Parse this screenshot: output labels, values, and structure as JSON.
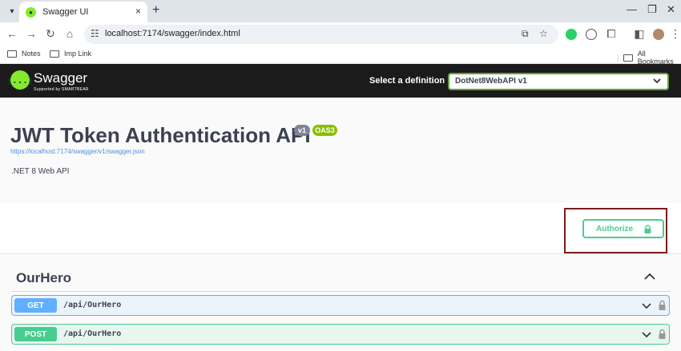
{
  "browser": {
    "tab_title": "Swagger UI",
    "tab_menu_icon": "chevron-down-icon",
    "close_glyph": "×",
    "new_tab_glyph": "+",
    "url": "localhost:7174/swagger/index.html",
    "bookmarks": [
      {
        "label": "Notes"
      },
      {
        "label": "Imp Link"
      }
    ],
    "all_bookmarks": "All Bookmarks"
  },
  "topbar": {
    "logo_text": "Swagger",
    "logo_sub": "Supported by SMARTBEAR",
    "logo_glyph": "{...}",
    "select_label": "Select a definition",
    "selected_definition": "DotNet8WebAPI v1"
  },
  "info": {
    "title": "JWT Token Authentication API",
    "version": "v1",
    "oas": "OAS3",
    "spec_url": "https://localhost:7174/swagger/v1/swagger.json",
    "description": ".NET 8 Web API"
  },
  "auth": {
    "button_label": "Authorize"
  },
  "tag": {
    "name": "OurHero"
  },
  "operations": [
    {
      "method": "GET",
      "path": "/api/OurHero"
    },
    {
      "method": "POST",
      "path": "/api/OurHero"
    }
  ],
  "colors": {
    "swagger_green": "#85ea2d",
    "get_blue": "#61affe",
    "post_green": "#49cc90",
    "topbar": "#1b1b1b",
    "highlight_border": "#7a1c1c"
  }
}
